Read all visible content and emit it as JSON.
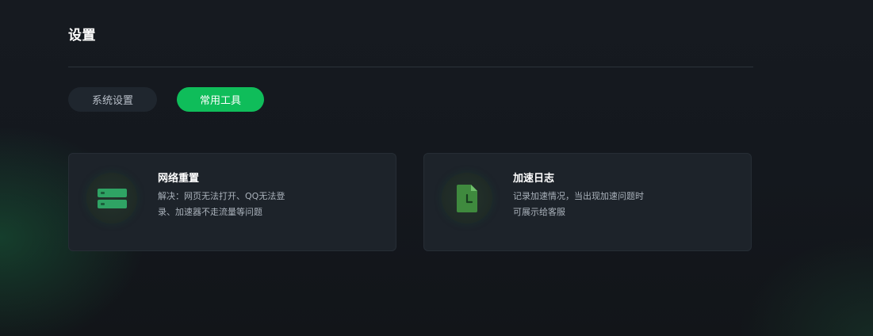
{
  "page": {
    "title": "设置"
  },
  "tabs": [
    {
      "label": "系统设置",
      "active": false
    },
    {
      "label": "常用工具",
      "active": true
    }
  ],
  "tools": [
    {
      "title": "网络重置",
      "desc_lines": [
        "解决：网页无法打开、QQ无法登",
        "录、加速器不走流量等问题"
      ],
      "icon": "server-icon"
    },
    {
      "title": "加速日志",
      "desc_lines": [
        "记录加速情况，当出现加速问题时",
        "可展示给客服"
      ],
      "icon": "log-file-icon"
    }
  ],
  "colors": {
    "accent": "#0fbd5a",
    "background": "#14181e",
    "card": "#1d232a"
  }
}
